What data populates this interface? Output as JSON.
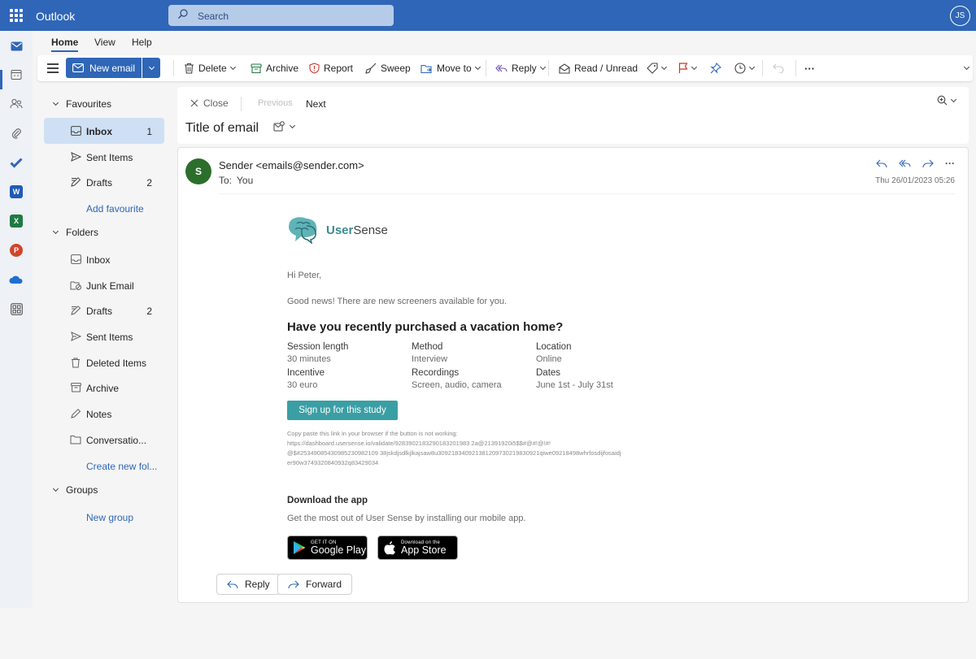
{
  "app": {
    "title": "Outlook",
    "user_initials": "JS"
  },
  "search": {
    "placeholder": "Search"
  },
  "rail": {
    "icons": [
      "mail-icon",
      "calendar-icon",
      "people-icon",
      "attachment-icon",
      "todo-icon",
      "word-icon",
      "excel-icon",
      "powerpoint-icon",
      "onedrive-icon",
      "apps-icon"
    ]
  },
  "menu": {
    "tabs": [
      "Home",
      "View",
      "Help"
    ]
  },
  "ribbon": {
    "new_email": "New email",
    "delete": "Delete",
    "archive": "Archive",
    "report": "Report",
    "sweep": "Sweep",
    "move_to": "Move to",
    "reply": "Reply",
    "read_unread": "Read / Unread",
    "more": "···"
  },
  "nav": {
    "favourites": {
      "title": "Favourites",
      "items": [
        {
          "label": "Inbox",
          "count": "1"
        },
        {
          "label": "Sent Items",
          "count": ""
        },
        {
          "label": "Drafts",
          "count": "2"
        }
      ],
      "add": "Add favourite"
    },
    "folders": {
      "title": "Folders",
      "items": [
        {
          "label": "Inbox",
          "count": ""
        },
        {
          "label": "Junk Email",
          "count": ""
        },
        {
          "label": "Drafts",
          "count": "2"
        },
        {
          "label": "Sent Items",
          "count": ""
        },
        {
          "label": "Deleted Items",
          "count": ""
        },
        {
          "label": "Archive",
          "count": ""
        },
        {
          "label": "Notes",
          "count": ""
        },
        {
          "label": "Conversatio...",
          "count": ""
        }
      ],
      "create": "Create new fol..."
    },
    "groups": {
      "title": "Groups",
      "new": "New group"
    }
  },
  "reading": {
    "close": "Close",
    "previous": "Previous",
    "next": "Next",
    "subject": "Title of email"
  },
  "message": {
    "avatar": "S",
    "sender": "Sender <emails@sender.com>",
    "to_label": "To:",
    "to_value": "You",
    "date": "Thu 26/01/2023 05:26",
    "logo_user": "User",
    "logo_sense": "Sense",
    "greeting": "Hi Peter,",
    "intro": "Good news! There are new screeners available for you.",
    "headline": "Have you recently purchased a vacation home?",
    "details": [
      {
        "key": "Session length",
        "value": "30 minutes"
      },
      {
        "key": "Method",
        "value": "Interview"
      },
      {
        "key": "Location",
        "value": "Online"
      },
      {
        "key": "Incentive",
        "value": "30 euro"
      },
      {
        "key": "Recordings",
        "value": "Screen, audio, camera"
      },
      {
        "key": "Dates",
        "value": "June 1st - July 31st"
      }
    ],
    "cta": "Sign up for this study",
    "copy_hint": "Copy paste this link in your browser if the button is not working:",
    "link_1": "https://dashboard.usersense.io/validate/9283902183290183201983 2a@21391920i5$$#@#!@!#!",
    "link_2": "@$#25349085430985230982109 38jskdjsdlkjlkajsaw8u309218340921381209730219830921qiwe09218498whrfosdijfosaidj",
    "link_3": "er90w3749320840932q83429034",
    "download_title": "Download the app",
    "download_text": "Get the most out of User Sense by installing our mobile app.",
    "gp_small": "GET IT ON",
    "gp_big": "Google Play",
    "as_small": "Download on the",
    "as_big": "App Store",
    "reply": "Reply",
    "forward": "Forward"
  },
  "colors": {
    "brand": "#2f66b7",
    "cta": "#3a9fa4",
    "avatar": "#2c6e2c",
    "nav_active": "#cfe0f5"
  }
}
